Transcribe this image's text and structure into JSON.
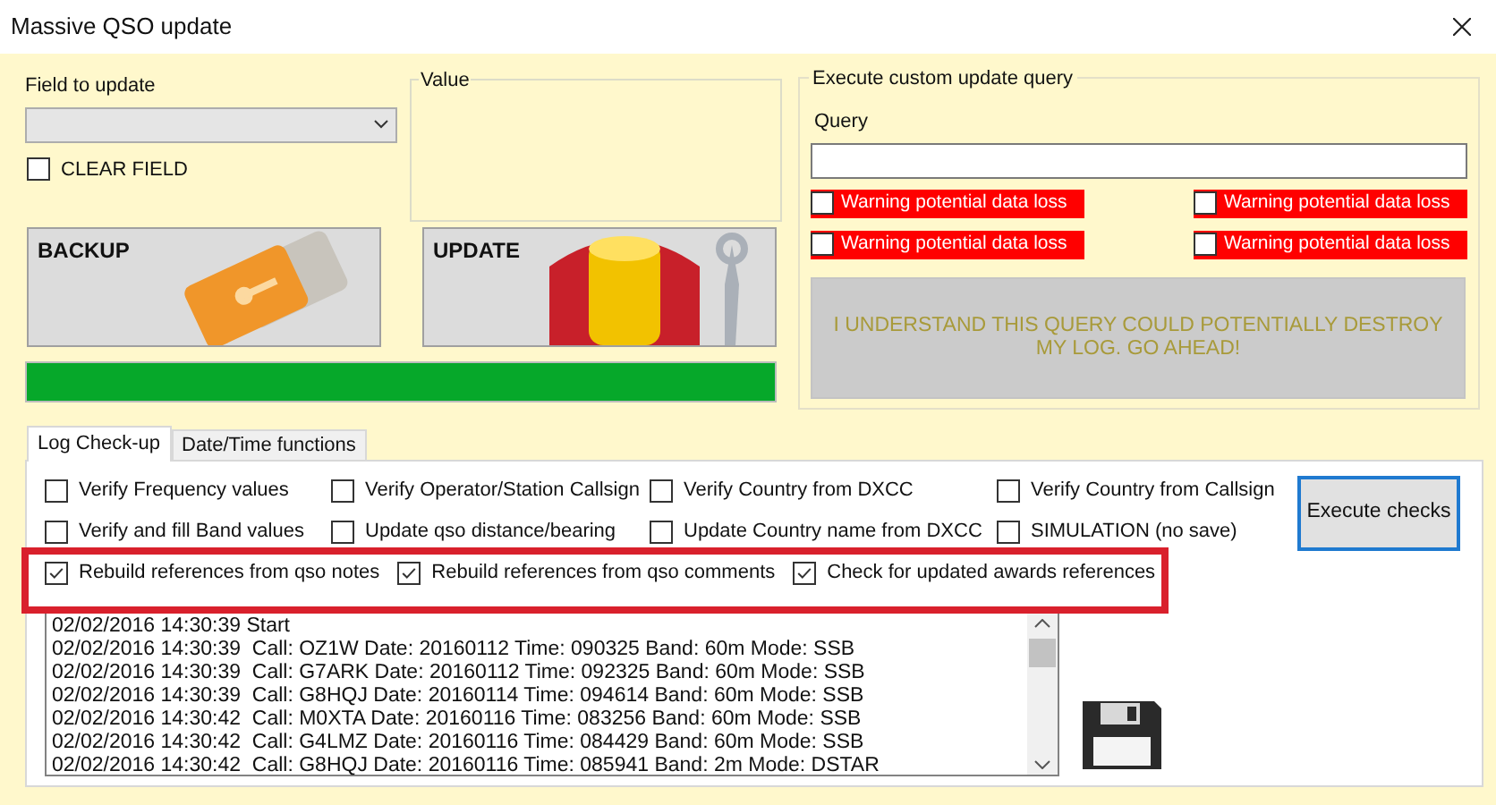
{
  "window": {
    "title": "Massive QSO update"
  },
  "field_to_update": {
    "label": "Field to update"
  },
  "clear_field": {
    "label": "CLEAR FIELD",
    "checked": false
  },
  "value_group": {
    "title": "Value"
  },
  "backup_button": {
    "label": "BACKUP"
  },
  "update_button": {
    "label": "UPDATE"
  },
  "progress": {
    "level": 1
  },
  "custom_query": {
    "title": "Execute custom update query",
    "query_label": "Query",
    "warnings": [
      {
        "label": "Warning potential data loss",
        "checked": false
      },
      {
        "label": "Warning potential data loss",
        "checked": false
      },
      {
        "label": "Warning potential data loss",
        "checked": false
      },
      {
        "label": "Warning potential data loss",
        "checked": false
      }
    ],
    "confirm_button": {
      "label": "I UNDERSTAND THIS QUERY COULD POTENTIALLY DESTROY MY LOG. GO AHEAD!",
      "disabled": true
    }
  },
  "tabs": [
    {
      "label": "Log Check-up",
      "selected": true
    },
    {
      "label": "Date/Time functions",
      "selected": false
    }
  ],
  "checks": [
    [
      {
        "label": "Verify Frequency values",
        "checked": false
      },
      {
        "label": "Verify Operator/Station Callsign",
        "checked": false
      },
      {
        "label": "Verify Country from DXCC",
        "checked": false
      },
      {
        "label": "Verify Country from Callsign",
        "checked": false
      }
    ],
    [
      {
        "label": "Verify and fill Band values",
        "checked": false
      },
      {
        "label": "Update qso distance/bearing",
        "checked": false
      },
      {
        "label": "Update Country name from DXCC",
        "checked": false
      },
      {
        "label": "SIMULATION (no save)",
        "checked": false
      }
    ],
    [
      {
        "label": "Rebuild references from qso notes",
        "checked": true
      },
      {
        "label": "Rebuild references from qso comments",
        "checked": true
      },
      {
        "label": "Check for updated awards references",
        "checked": true
      }
    ]
  ],
  "execute_button": {
    "label": "Execute checks"
  },
  "log": [
    "02/02/2016 14:30:39 Start",
    "02/02/2016 14:30:39  Call: OZ1W Date: 20160112 Time: 090325 Band: 60m Mode: SSB",
    "02/02/2016 14:30:39  Call: G7ARK Date: 20160112 Time: 092325 Band: 60m Mode: SSB",
    "02/02/2016 14:30:39  Call: G8HQJ Date: 20160114 Time: 094614 Band: 60m Mode: SSB",
    "02/02/2016 14:30:42  Call: M0XTA Date: 20160116 Time: 083256 Band: 60m Mode: SSB",
    "02/02/2016 14:30:42  Call: G4LMZ Date: 20160116 Time: 084429 Band: 60m Mode: SSB",
    "02/02/2016 14:30:42  Call: G8HQJ Date: 20160116 Time: 085941 Band: 2m Mode: DSTAR"
  ]
}
